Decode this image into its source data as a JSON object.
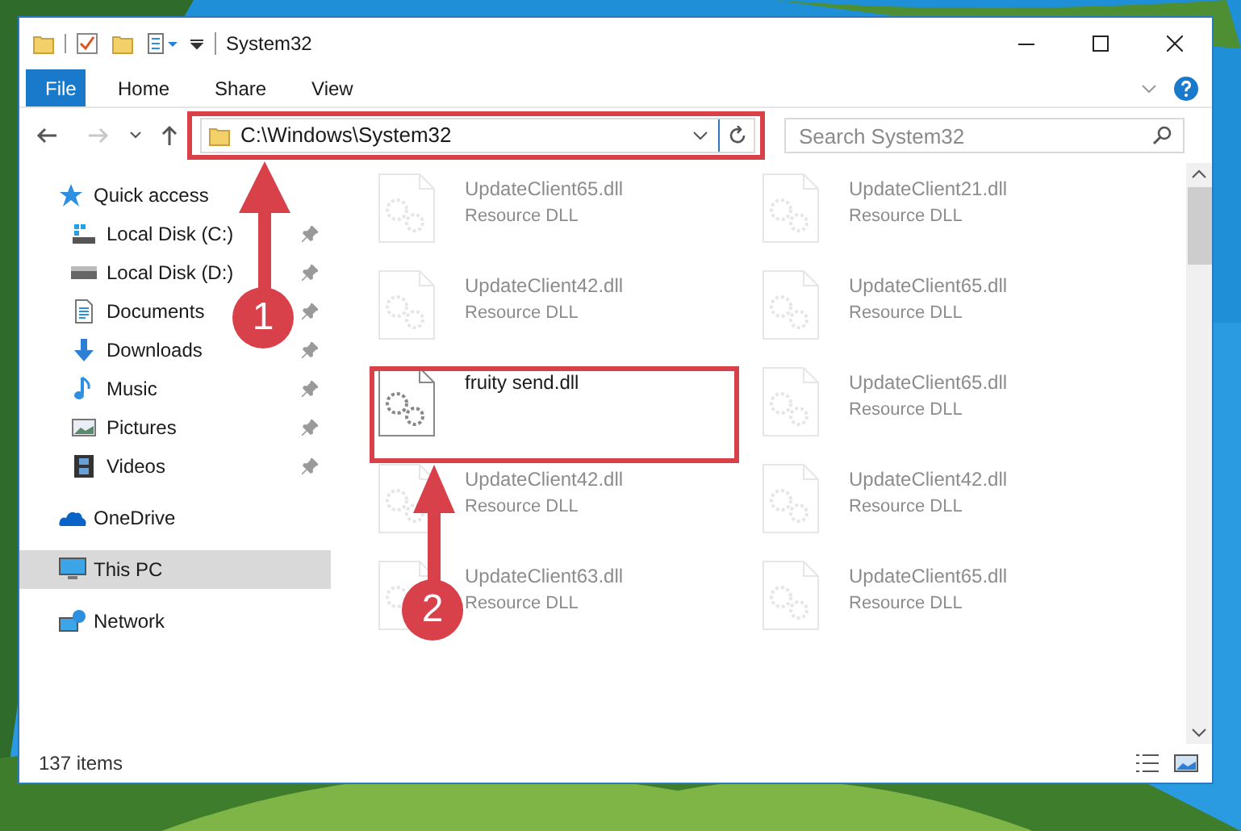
{
  "window": {
    "title": "System32"
  },
  "ribbon_tabs": [
    {
      "label": "File",
      "kind": "file"
    },
    {
      "label": "Home",
      "kind": "tab"
    },
    {
      "label": "Share",
      "kind": "tab"
    },
    {
      "label": "View",
      "kind": "tab"
    }
  ],
  "address_bar": {
    "path": "C:\\Windows\\System32"
  },
  "search": {
    "placeholder": "Search System32"
  },
  "sidebar": {
    "items": [
      {
        "label": "Quick access",
        "kind": "quick",
        "selected": false,
        "children": [
          {
            "label": "Local Disk (C:)",
            "kind": "diskc",
            "pinned": true
          },
          {
            "label": "Local Disk (D:)",
            "kind": "disk",
            "pinned": true
          },
          {
            "label": "Documents",
            "kind": "documents",
            "pinned": true
          },
          {
            "label": "Downloads",
            "kind": "downloads",
            "pinned": true
          },
          {
            "label": "Music",
            "kind": "music",
            "pinned": true
          },
          {
            "label": "Pictures",
            "kind": "pictures",
            "pinned": true
          },
          {
            "label": "Videos",
            "kind": "videos",
            "pinned": true
          }
        ]
      },
      {
        "label": "OneDrive",
        "kind": "cloud",
        "selected": false
      },
      {
        "label": "This PC",
        "kind": "pc",
        "selected": true
      },
      {
        "label": "Network",
        "kind": "network",
        "selected": false
      }
    ]
  },
  "files": [
    {
      "name": "UpdateClient65.dll",
      "type": "Resource DLL",
      "blurred": true
    },
    {
      "name": "UpdateClient21.dll",
      "type": "Resource DLL",
      "blurred": true
    },
    {
      "name": "UpdateClient42.dll",
      "type": "Resource DLL",
      "blurred": true
    },
    {
      "name": "UpdateClient65.dll",
      "type": "Resource DLL",
      "blurred": true
    },
    {
      "name": "fruity send.dll",
      "blurred": false
    },
    {
      "name": "UpdateClient65.dll",
      "type": "Resource DLL",
      "blurred": true
    },
    {
      "name": "UpdateClient42.dll",
      "type": "Resource DLL",
      "blurred": true
    },
    {
      "name": "UpdateClient42.dll",
      "type": "Resource DLL",
      "blurred": true
    },
    {
      "name": "UpdateClient63.dll",
      "type": "Resource DLL",
      "blurred": true
    },
    {
      "name": "UpdateClient65.dll",
      "type": "Resource DLL",
      "blurred": true
    }
  ],
  "status_bar": {
    "count": "137 items"
  },
  "annotations": [
    {
      "label": "1"
    },
    {
      "label": "2"
    }
  ]
}
